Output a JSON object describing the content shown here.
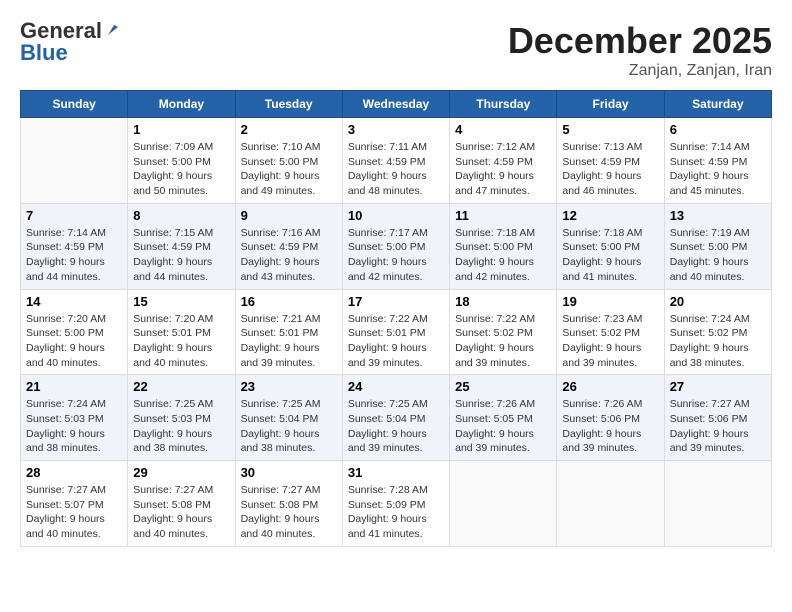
{
  "logo": {
    "general": "General",
    "blue": "Blue"
  },
  "header": {
    "month": "December 2025",
    "location": "Zanjan, Zanjan, Iran"
  },
  "days_of_week": [
    "Sunday",
    "Monday",
    "Tuesday",
    "Wednesday",
    "Thursday",
    "Friday",
    "Saturday"
  ],
  "weeks": [
    [
      {
        "day": null
      },
      {
        "day": 1,
        "sunrise": "7:09 AM",
        "sunset": "5:00 PM",
        "daylight": "9 hours and 50 minutes."
      },
      {
        "day": 2,
        "sunrise": "7:10 AM",
        "sunset": "5:00 PM",
        "daylight": "9 hours and 49 minutes."
      },
      {
        "day": 3,
        "sunrise": "7:11 AM",
        "sunset": "4:59 PM",
        "daylight": "9 hours and 48 minutes."
      },
      {
        "day": 4,
        "sunrise": "7:12 AM",
        "sunset": "4:59 PM",
        "daylight": "9 hours and 47 minutes."
      },
      {
        "day": 5,
        "sunrise": "7:13 AM",
        "sunset": "4:59 PM",
        "daylight": "9 hours and 46 minutes."
      },
      {
        "day": 6,
        "sunrise": "7:14 AM",
        "sunset": "4:59 PM",
        "daylight": "9 hours and 45 minutes."
      }
    ],
    [
      {
        "day": 7,
        "sunrise": "7:14 AM",
        "sunset": "4:59 PM",
        "daylight": "9 hours and 44 minutes."
      },
      {
        "day": 8,
        "sunrise": "7:15 AM",
        "sunset": "4:59 PM",
        "daylight": "9 hours and 44 minutes."
      },
      {
        "day": 9,
        "sunrise": "7:16 AM",
        "sunset": "4:59 PM",
        "daylight": "9 hours and 43 minutes."
      },
      {
        "day": 10,
        "sunrise": "7:17 AM",
        "sunset": "5:00 PM",
        "daylight": "9 hours and 42 minutes."
      },
      {
        "day": 11,
        "sunrise": "7:18 AM",
        "sunset": "5:00 PM",
        "daylight": "9 hours and 42 minutes."
      },
      {
        "day": 12,
        "sunrise": "7:18 AM",
        "sunset": "5:00 PM",
        "daylight": "9 hours and 41 minutes."
      },
      {
        "day": 13,
        "sunrise": "7:19 AM",
        "sunset": "5:00 PM",
        "daylight": "9 hours and 40 minutes."
      }
    ],
    [
      {
        "day": 14,
        "sunrise": "7:20 AM",
        "sunset": "5:00 PM",
        "daylight": "9 hours and 40 minutes."
      },
      {
        "day": 15,
        "sunrise": "7:20 AM",
        "sunset": "5:01 PM",
        "daylight": "9 hours and 40 minutes."
      },
      {
        "day": 16,
        "sunrise": "7:21 AM",
        "sunset": "5:01 PM",
        "daylight": "9 hours and 39 minutes."
      },
      {
        "day": 17,
        "sunrise": "7:22 AM",
        "sunset": "5:01 PM",
        "daylight": "9 hours and 39 minutes."
      },
      {
        "day": 18,
        "sunrise": "7:22 AM",
        "sunset": "5:02 PM",
        "daylight": "9 hours and 39 minutes."
      },
      {
        "day": 19,
        "sunrise": "7:23 AM",
        "sunset": "5:02 PM",
        "daylight": "9 hours and 39 minutes."
      },
      {
        "day": 20,
        "sunrise": "7:24 AM",
        "sunset": "5:02 PM",
        "daylight": "9 hours and 38 minutes."
      }
    ],
    [
      {
        "day": 21,
        "sunrise": "7:24 AM",
        "sunset": "5:03 PM",
        "daylight": "9 hours and 38 minutes."
      },
      {
        "day": 22,
        "sunrise": "7:25 AM",
        "sunset": "5:03 PM",
        "daylight": "9 hours and 38 minutes."
      },
      {
        "day": 23,
        "sunrise": "7:25 AM",
        "sunset": "5:04 PM",
        "daylight": "9 hours and 38 minutes."
      },
      {
        "day": 24,
        "sunrise": "7:25 AM",
        "sunset": "5:04 PM",
        "daylight": "9 hours and 39 minutes."
      },
      {
        "day": 25,
        "sunrise": "7:26 AM",
        "sunset": "5:05 PM",
        "daylight": "9 hours and 39 minutes."
      },
      {
        "day": 26,
        "sunrise": "7:26 AM",
        "sunset": "5:06 PM",
        "daylight": "9 hours and 39 minutes."
      },
      {
        "day": 27,
        "sunrise": "7:27 AM",
        "sunset": "5:06 PM",
        "daylight": "9 hours and 39 minutes."
      }
    ],
    [
      {
        "day": 28,
        "sunrise": "7:27 AM",
        "sunset": "5:07 PM",
        "daylight": "9 hours and 40 minutes."
      },
      {
        "day": 29,
        "sunrise": "7:27 AM",
        "sunset": "5:08 PM",
        "daylight": "9 hours and 40 minutes."
      },
      {
        "day": 30,
        "sunrise": "7:27 AM",
        "sunset": "5:08 PM",
        "daylight": "9 hours and 40 minutes."
      },
      {
        "day": 31,
        "sunrise": "7:28 AM",
        "sunset": "5:09 PM",
        "daylight": "9 hours and 41 minutes."
      },
      {
        "day": null
      },
      {
        "day": null
      },
      {
        "day": null
      }
    ]
  ]
}
